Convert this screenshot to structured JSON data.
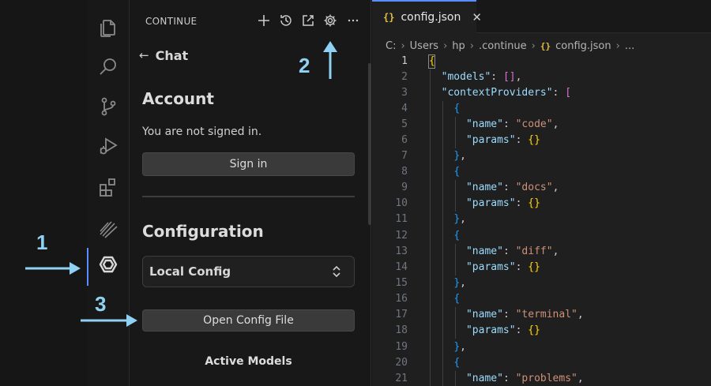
{
  "sidebar": {
    "title": "CONTINUE",
    "back_label": "Chat",
    "account_heading": "Account",
    "signed_in_text": "You are not signed in.",
    "sign_in_label": "Sign in",
    "configuration_heading": "Configuration",
    "config_select_value": "Local Config",
    "open_config_label": "Open Config File",
    "active_models_heading": "Active Models"
  },
  "header_icons": [
    "plus-icon",
    "history-icon",
    "open-external-icon",
    "gear-icon",
    "more-icon"
  ],
  "activity_icons": [
    "files-icon",
    "search-icon",
    "source-control-icon",
    "run-debug-icon",
    "extensions-icon",
    "stripes-icon",
    "continue-icon"
  ],
  "editor": {
    "tab_icon": "{}",
    "tab_name": "config.json",
    "breadcrumb": [
      "C:",
      "Users",
      "hp",
      ".continue",
      "config.json",
      "..."
    ],
    "lines": [
      {
        "n": "1"
      },
      {
        "n": "2"
      },
      {
        "n": "3"
      },
      {
        "n": "4"
      },
      {
        "n": "5"
      },
      {
        "n": "6"
      },
      {
        "n": "7"
      },
      {
        "n": "8"
      },
      {
        "n": "9"
      },
      {
        "n": "10"
      },
      {
        "n": "11"
      },
      {
        "n": "12"
      },
      {
        "n": "13"
      },
      {
        "n": "14"
      },
      {
        "n": "15"
      },
      {
        "n": "16"
      },
      {
        "n": "17"
      },
      {
        "n": "18"
      },
      {
        "n": "19"
      },
      {
        "n": "20"
      },
      {
        "n": "21"
      }
    ],
    "keys": {
      "models": "\"models\"",
      "contextProviders": "\"contextProviders\"",
      "name": "\"name\"",
      "params": "\"params\""
    },
    "providers": [
      "\"code\"",
      "\"docs\"",
      "\"diff\"",
      "\"terminal\"",
      "\"problems\""
    ]
  },
  "annotations": [
    "1",
    "2",
    "3"
  ],
  "colors": {
    "accent": "#5b8cff",
    "annotation": "#8fd1f2",
    "json_key": "#9cdcfe",
    "json_string": "#ce9178"
  }
}
